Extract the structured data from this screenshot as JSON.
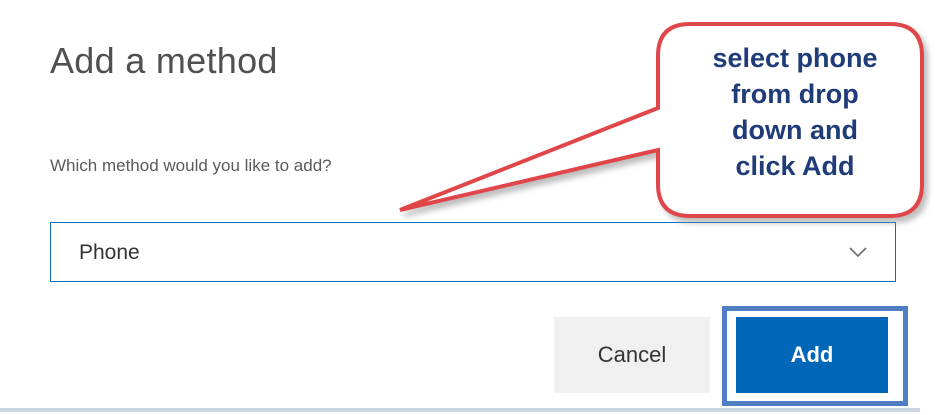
{
  "dialog": {
    "title": "Add a method",
    "question": "Which method would you like to add?",
    "method_select": {
      "selected_value": "Phone"
    },
    "buttons": {
      "cancel_label": "Cancel",
      "add_label": "Add"
    }
  },
  "annotation": {
    "callout_lines": [
      "select phone",
      "from drop",
      "down and",
      "click Add"
    ],
    "callout_border_color": "#e0454a",
    "callout_text_color": "#1f3b78",
    "highlight_color": "#4f7ec2"
  },
  "colors": {
    "accent": "#0067b8",
    "select_border": "#0f6cbd"
  }
}
